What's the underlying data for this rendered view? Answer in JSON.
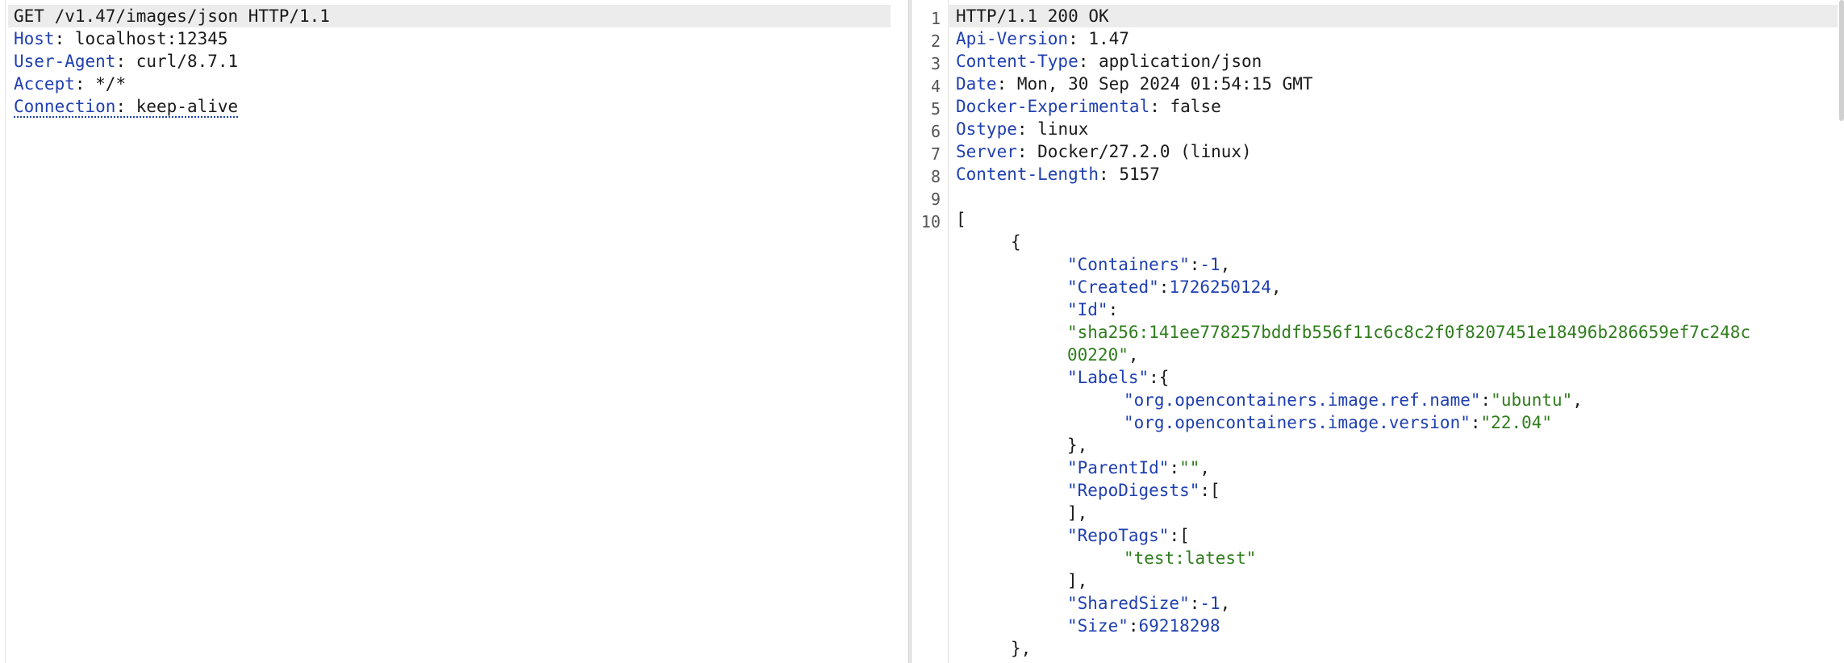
{
  "request": {
    "request_line": "GET /v1.47/images/json HTTP/1.1",
    "headers": [
      {
        "key": "Host",
        "value": "localhost:12345"
      },
      {
        "key": "User-Agent",
        "value": "curl/8.7.1"
      },
      {
        "key": "Accept",
        "value": "*/*"
      },
      {
        "key": "Connection",
        "value": "keep-alive"
      }
    ]
  },
  "response": {
    "line_numbers": [
      "1",
      "2",
      "3",
      "4",
      "5",
      "6",
      "7",
      "8",
      "9",
      "10"
    ],
    "status_line": "HTTP/1.1 200 OK",
    "headers": [
      {
        "key": "Api-Version",
        "value": "1.47"
      },
      {
        "key": "Content-Type",
        "value": "application/json"
      },
      {
        "key": "Date",
        "value": "Mon, 30 Sep 2024 01:54:15 GMT"
      },
      {
        "key": "Docker-Experimental",
        "value": "false"
      },
      {
        "key": "Ostype",
        "value": "linux"
      },
      {
        "key": "Server",
        "value": "Docker/27.2.0 (linux)"
      },
      {
        "key": "Content-Length",
        "value": "5157"
      }
    ],
    "body": {
      "open_bracket": "[",
      "open_brace": "{",
      "containers_key": "\"Containers\"",
      "containers_val": "-1",
      "created_key": "\"Created\"",
      "created_val": "1726250124",
      "id_key": "\"Id\"",
      "id_val_1": "\"sha256:141ee778257bddfb556f11c6c8c2f0f8207451e18496b286659ef7c248c",
      "id_val_2": "00220\"",
      "labels_key": "\"Labels\"",
      "label1_key": "\"org.opencontainers.image.ref.name\"",
      "label1_val": "\"ubuntu\"",
      "label2_key": "\"org.opencontainers.image.version\"",
      "label2_val": "\"22.04\"",
      "labels_close": "},",
      "parentid_key": "\"ParentId\"",
      "parentid_val": "\"\"",
      "repodigests_key": "\"RepoDigests\"",
      "repodigests_close": "],",
      "repotags_key": "\"RepoTags\"",
      "repotag_1": "\"test:latest\"",
      "repotags_close": "],",
      "sharedsize_key": "\"SharedSize\"",
      "sharedsize_val": "-1",
      "size_key": "\"Size\"",
      "size_val": "69218298",
      "close_brace": "},"
    }
  }
}
